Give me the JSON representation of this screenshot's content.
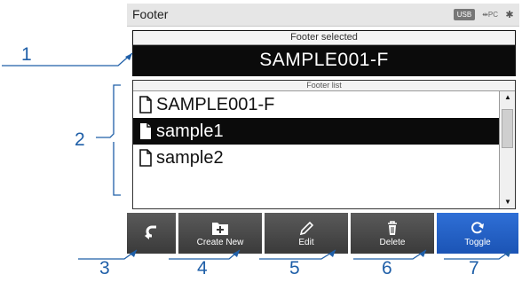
{
  "screen": {
    "title": "Footer",
    "status": {
      "usb_label": "USB",
      "pc_label": "PC",
      "bluetooth_glyph": "✱"
    },
    "footer_selected": {
      "caption": "Footer selected",
      "value": "SAMPLE001-F"
    },
    "footer_list": {
      "caption": "Footer list",
      "items": [
        {
          "label": "SAMPLE001-F",
          "selected": false
        },
        {
          "label": "sample1",
          "selected": true
        },
        {
          "label": "sample2",
          "selected": false
        }
      ]
    },
    "toolbar": {
      "back_label": "",
      "create_label": "Create New",
      "edit_label": "Edit",
      "delete_label": "Delete",
      "toggle_label": "Toggle"
    }
  },
  "callouts": [
    "1",
    "2",
    "3",
    "4",
    "5",
    "6",
    "7"
  ],
  "colors": {
    "accent": "#1f5fa8",
    "toggle": "#2a66cc",
    "selected_bg": "#0b0b0b"
  }
}
